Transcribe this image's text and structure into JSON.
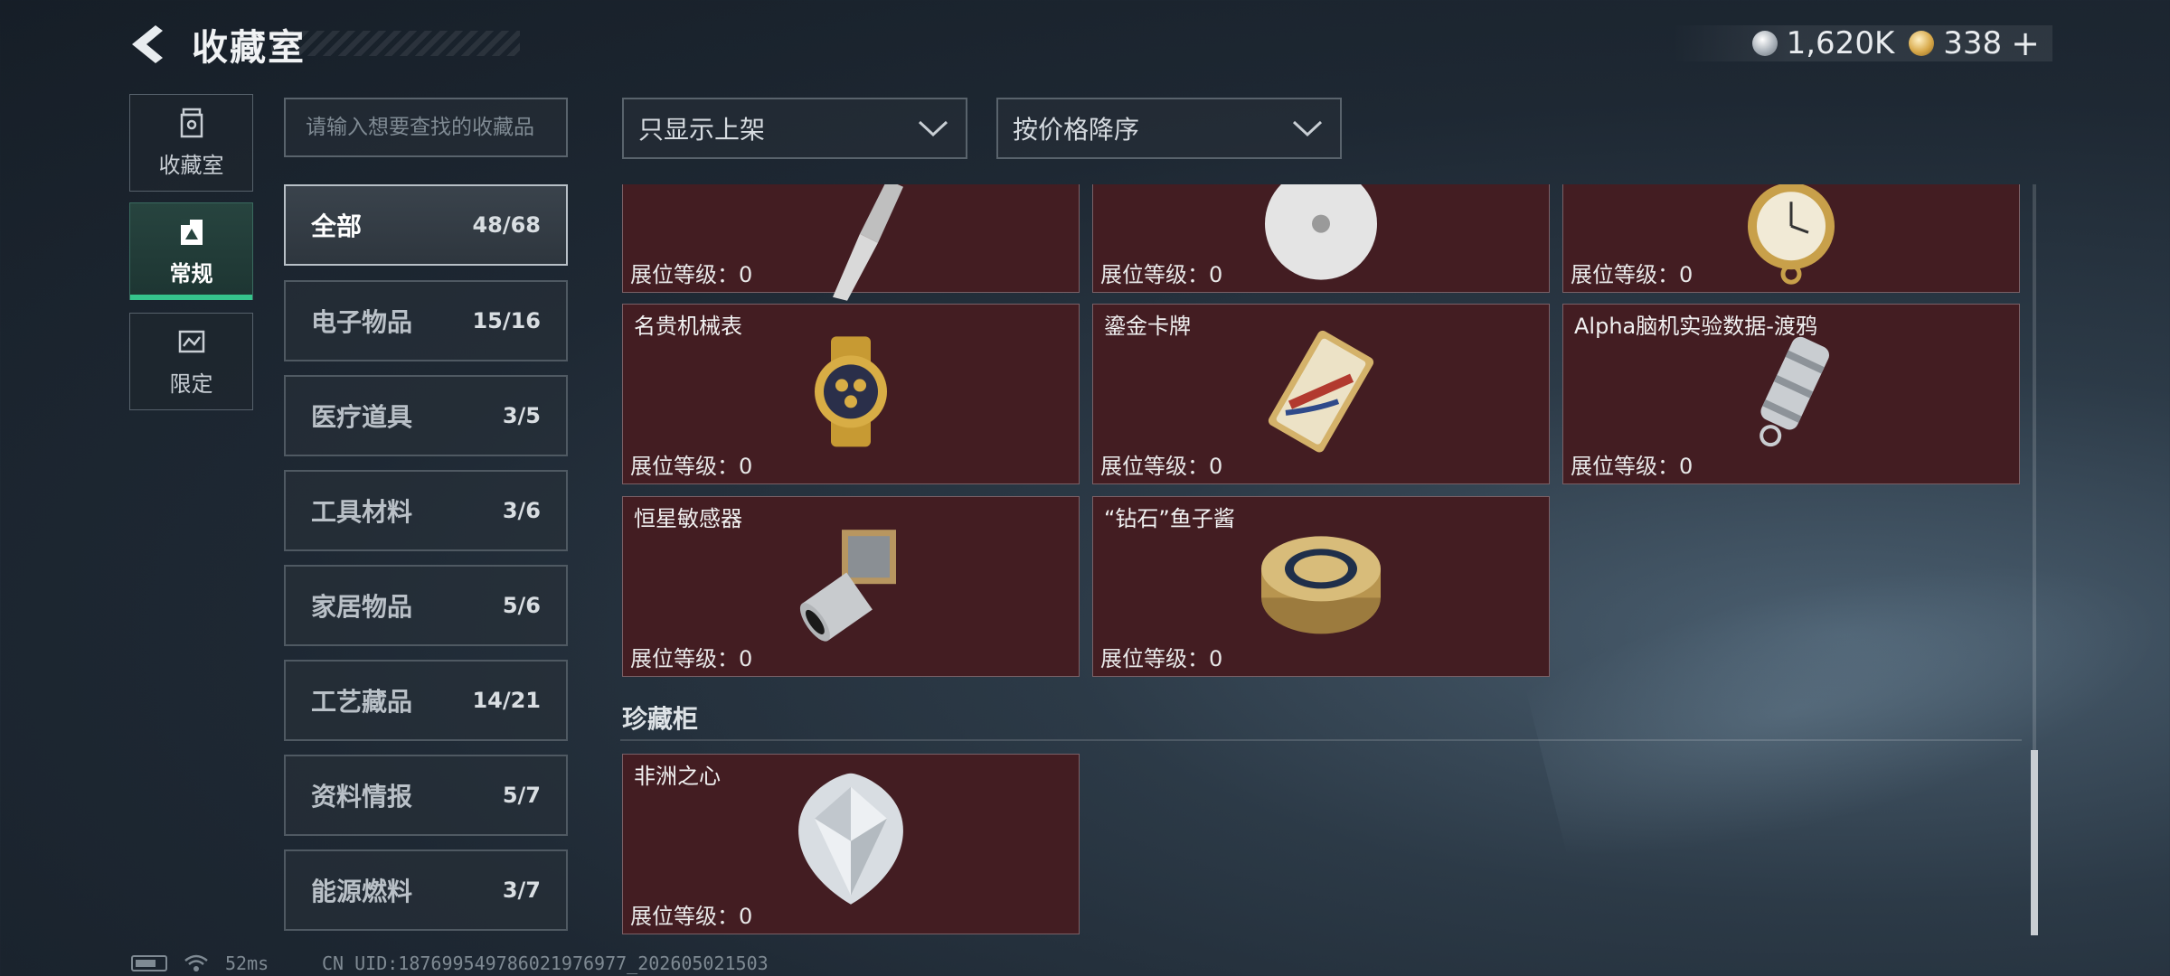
{
  "header": {
    "title": "收藏室",
    "currency": [
      {
        "icon": "silver-coin-icon",
        "value": "1,620K"
      },
      {
        "icon": "gold-coin-icon",
        "value": "338"
      }
    ],
    "plus_label": "+"
  },
  "side_tabs": [
    {
      "label": "收藏室",
      "icon": "collection-room-icon",
      "active": false
    },
    {
      "label": "常规",
      "icon": "regular-icon",
      "active": true
    },
    {
      "label": "限定",
      "icon": "limited-icon",
      "active": false
    }
  ],
  "search": {
    "placeholder": "请输入想要查找的收藏品",
    "value": ""
  },
  "filters": {
    "shelf_filter": "只显示上架",
    "sort_order": "按价格降序"
  },
  "categories": [
    {
      "name": "全部",
      "count": "48/68",
      "active": true
    },
    {
      "name": "电子物品",
      "count": "15/16"
    },
    {
      "name": "医疗道具",
      "count": "3/5"
    },
    {
      "name": "工具材料",
      "count": "3/6"
    },
    {
      "name": "家居物品",
      "count": "5/6"
    },
    {
      "name": "工艺藏品",
      "count": "14/21"
    },
    {
      "name": "资料情报",
      "count": "5/7"
    },
    {
      "name": "能源燃料",
      "count": "3/7"
    }
  ],
  "level_prefix": "展位等级：",
  "items": [
    {
      "name": "",
      "level": "展位等级：0",
      "art": "pen-item-icon"
    },
    {
      "name": "",
      "level": "展位等级：0",
      "art": "disc-item-icon"
    },
    {
      "name": "",
      "level": "展位等级：0",
      "art": "pocket-watch-item-icon"
    },
    {
      "name": "名贵机械表",
      "level": "展位等级：0",
      "art": "wristwatch-item-icon"
    },
    {
      "name": "鎏金卡牌",
      "level": "展位等级：0",
      "art": "gold-card-item-icon"
    },
    {
      "name": "Alpha脑机实验数据-渡鸦",
      "level": "展位等级：0",
      "art": "data-cylinder-item-icon"
    },
    {
      "name": "恒星敏感器",
      "level": "展位等级：0",
      "art": "star-sensor-item-icon"
    },
    {
      "name": "“钻石”鱼子酱",
      "level": "展位等级：0",
      "art": "caviar-tin-item-icon"
    }
  ],
  "treasure_section": {
    "title": "珍藏柜",
    "items": [
      {
        "name": "非洲之心",
        "level": "展位等级：0",
        "art": "diamond-item-icon"
      }
    ]
  },
  "status_bar": {
    "latency": "52ms",
    "uid": "CN UID:1876995497860219769​77_202605021503"
  }
}
